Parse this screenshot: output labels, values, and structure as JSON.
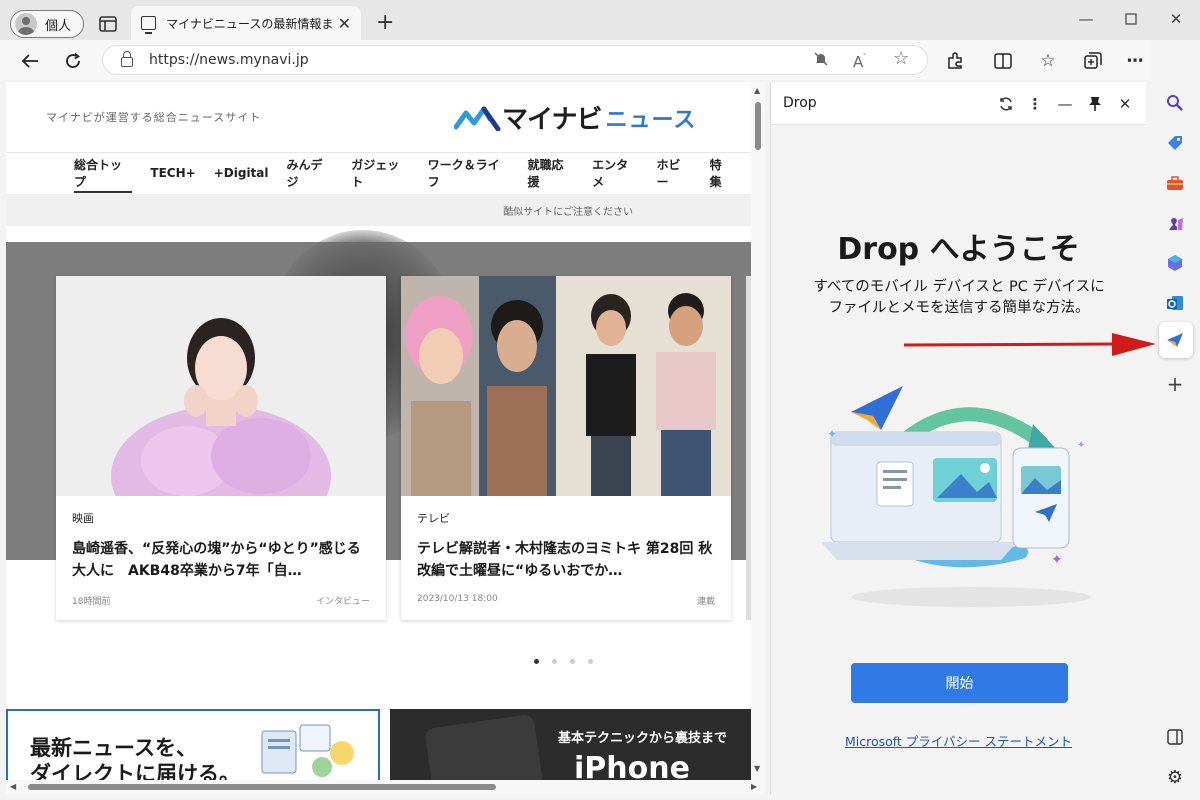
{
  "browser": {
    "profile_label": "個人",
    "tab_title": "マイナビニュースの最新情報まとめ - エ",
    "url": "https://news.mynavi.jp",
    "accent_color": "#2f7ae5"
  },
  "site": {
    "tagline": "マイナビが運営する総合ニュースサイト",
    "logo_main": "マイナビ",
    "logo_sub": "ニュース",
    "nav": [
      "総合トップ",
      "TECH+",
      "+Digital",
      "みんデジ",
      "ガジェット",
      "ワーク＆ライフ",
      "就職応援",
      "エンタメ",
      "ホビー",
      "特集"
    ],
    "notice": "酷似サイトにご注意ください",
    "cards": [
      {
        "category": "映画",
        "headline": "島崎遥香、“反発心の塊”から“ゆとり”感じる大人に　AKB48卒業から7年「自…",
        "time": "18時間前",
        "tag": "インタビュー"
      },
      {
        "category": "テレビ",
        "headline": "テレビ解説者・木村隆志のヨミトキ 第28回 秋改編で土曜昼に“ゆるいおでか…",
        "time": "2023/10/13 18:00",
        "tag": "連載"
      }
    ],
    "carousel_active_index": 0,
    "carousel_count": 4,
    "banner1": {
      "line1": "最新ニュースを、",
      "line2": "ダイレクトに届ける。"
    },
    "banner2": {
      "top": "基本テクニックから裏技まで",
      "big": "iPhone"
    }
  },
  "drop_panel": {
    "title": "Drop",
    "welcome": "Drop へようこそ",
    "description": "すべてのモバイル デバイスと PC デバイスにファイルとメモを送信する簡単な方法。",
    "start_button": "開始",
    "privacy_link": "Microsoft プライバシー ステートメント"
  },
  "sidebar": {
    "icons": [
      "search-icon",
      "shopping-tag-icon",
      "tools-icon",
      "games-icon",
      "microsoft365-icon",
      "outlook-icon",
      "drop-icon",
      "add-icon",
      "hide-sidebar-icon",
      "settings-icon"
    ],
    "active": "drop-icon"
  }
}
